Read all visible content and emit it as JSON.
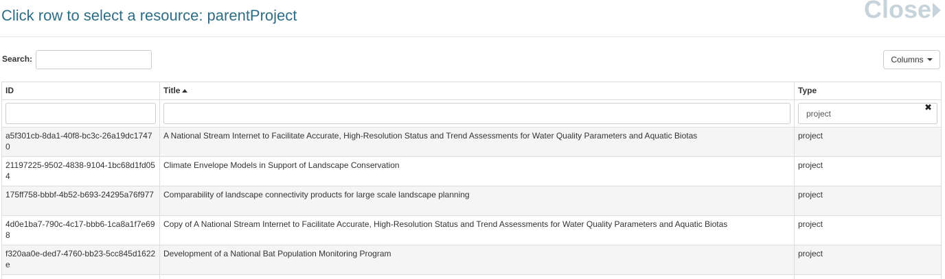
{
  "dialog": {
    "title": "Click row to select a resource: parentProject",
    "close_label": "Close"
  },
  "toolbar": {
    "search_label": "Search:",
    "search_value": "",
    "columns_label": "Columns"
  },
  "table": {
    "headers": {
      "id": "ID",
      "title": "Title",
      "type": "Type"
    },
    "sort": {
      "column": "title",
      "direction": "ascending"
    },
    "filters": {
      "id": "",
      "title": "",
      "type": "project"
    },
    "rows": [
      {
        "id": "a5f301cb-8da1-40f8-bc3c-26a19dc17470",
        "title": "A National Stream Internet to Facilitate Accurate, High-Resolution Status and Trend Assessments for Water Quality Parameters and Aquatic Biotas",
        "type": "project"
      },
      {
        "id": "21197225-9502-4838-9104-1bc68d1fd054",
        "title": "Climate Envelope Models in Support of Landscape Conservation",
        "type": "project"
      },
      {
        "id": "175ff758-bbbf-4b52-b693-24295a76f977",
        "title": "Comparability of landscape connectivity products for large scale landscape planning",
        "type": "project"
      },
      {
        "id": "4d0e1ba7-790c-4c17-bbb6-1ca8a1f7e698",
        "title": "Copy of A National Stream Internet to Facilitate Accurate, High-Resolution Status and Trend Assessments for Water Quality Parameters and Aquatic Biotas",
        "type": "project"
      },
      {
        "id": "f320aa0e-ded7-4760-bb23-5cc845d1622e",
        "title": "Development of a National Bat Population Monitoring Program",
        "type": "project"
      }
    ]
  },
  "colors": {
    "title": "#2e6d85",
    "close": "#c7d3da",
    "stripe": "#f5f5f5",
    "border": "#dddddd"
  },
  "icons": {
    "close": "chevron-right-icon",
    "columns": "caret-down-icon",
    "sort": "sort-ascending-icon",
    "clear_filter": "clear-filter-icon"
  }
}
